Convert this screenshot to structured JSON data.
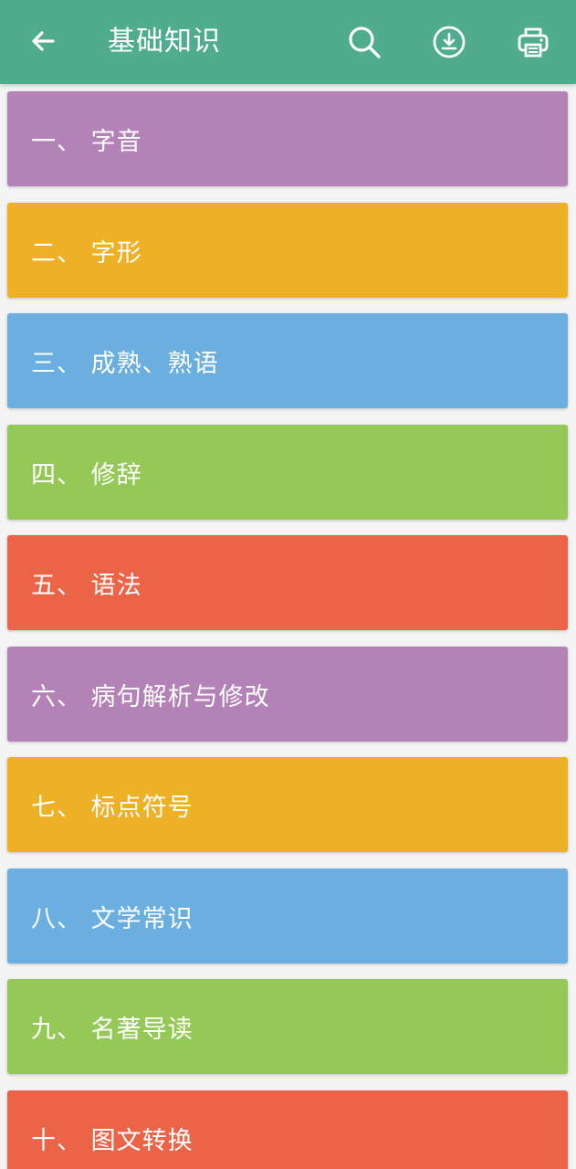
{
  "colors": {
    "app_bar": "#4fad8d",
    "purple": "#b382b6",
    "yellow": "#eeb024",
    "blue": "#6aafe0",
    "green": "#95c957",
    "orange": "#ec6448"
  },
  "header": {
    "title": "基础知识",
    "icons": [
      "back-arrow-icon",
      "search-icon",
      "download-icon",
      "print-icon"
    ]
  },
  "items": [
    {
      "label": "一、 字音",
      "color": "#b382b6"
    },
    {
      "label": "二、 字形",
      "color": "#eeb024"
    },
    {
      "label": "三、 成熟、熟语",
      "color": "#6aafe0"
    },
    {
      "label": "四、 修辞",
      "color": "#95c957"
    },
    {
      "label": "五、 语法",
      "color": "#ec6448"
    },
    {
      "label": "六、 病句解析与修改",
      "color": "#b382b6"
    },
    {
      "label": "七、 标点符号",
      "color": "#eeb024"
    },
    {
      "label": "八、 文学常识",
      "color": "#6aafe0"
    },
    {
      "label": "九、 名著导读",
      "color": "#95c957"
    },
    {
      "label": "十、 图文转换",
      "color": "#ec6448"
    }
  ]
}
